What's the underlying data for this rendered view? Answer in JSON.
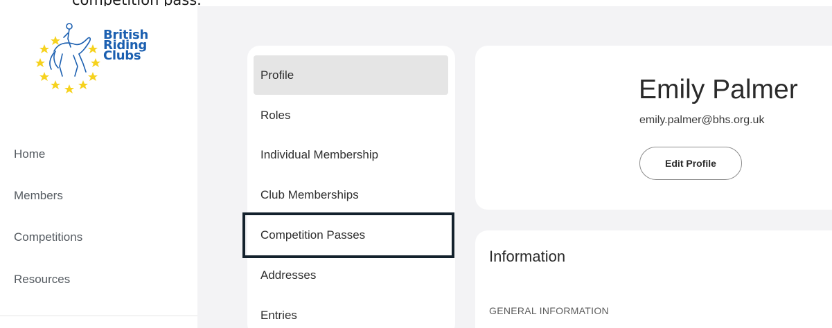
{
  "caption": "competition pass.",
  "brand": {
    "line1": "British",
    "line2": "Riding",
    "line3": "Clubs",
    "text_color": "#1b5fb0",
    "star_color": "#f6d21e"
  },
  "nav": {
    "items": [
      {
        "label": "Home"
      },
      {
        "label": "Members"
      },
      {
        "label": "Competitions"
      },
      {
        "label": "Resources"
      }
    ]
  },
  "profile_menu": {
    "items": [
      {
        "label": "Profile",
        "active": true
      },
      {
        "label": "Roles"
      },
      {
        "label": "Individual Membership"
      },
      {
        "label": "Club Memberships"
      },
      {
        "label": "Competition Passes",
        "focused": true
      },
      {
        "label": "Addresses"
      },
      {
        "label": "Entries"
      }
    ]
  },
  "profile": {
    "name": "Emily Palmer",
    "email": "emily.palmer@bhs.org.uk",
    "edit_label": "Edit Profile"
  },
  "information": {
    "title": "Information",
    "section_label": "GENERAL INFORMATION"
  },
  "colors": {
    "page_bg": "#f3f3f5",
    "active_item_bg": "#e5e5e5",
    "focus_ring": "#13212c"
  }
}
